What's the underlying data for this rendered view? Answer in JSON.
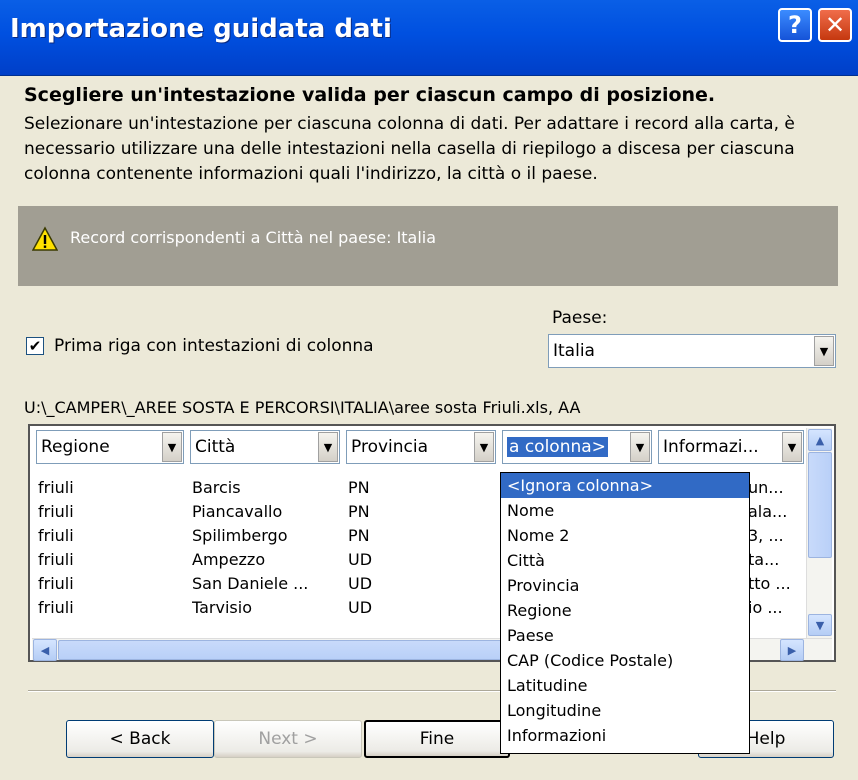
{
  "window": {
    "title": "Importazione guidata dati",
    "help_button": "?",
    "close_button": "✕"
  },
  "header": {
    "heading": "Scegliere un'intestazione valida per ciascun campo di posizione.",
    "description": "Selezionare un'intestazione per ciascuna colonna di dati. Per adattare i record alla carta, è necessario utilizzare una delle intestazioni nella casella di riepilogo a discesa per ciascuna colonna contenente informazioni quali l'indirizzo, la città o il paese."
  },
  "warning": {
    "text": "Record corrispondenti a Città nel paese: Italia",
    "icon": "warning-icon"
  },
  "options": {
    "first_row_label": "Prima riga con intestazioni di colonna",
    "first_row_checked": true,
    "country_label": "Paese:",
    "country_value": "Italia"
  },
  "file_path": "U:\\_CAMPER\\_AREE SOSTA E PERCORSI\\ITALIA\\aree sosta Friuli.xls, AA",
  "grid": {
    "headers": [
      "Regione",
      "Città",
      "Provincia",
      "a colonna>",
      "Informazi..."
    ],
    "rows": [
      [
        "friuli",
        "Barcis",
        "PN",
        "",
        "un..."
      ],
      [
        "friuli",
        "Piancavallo",
        "PN",
        "",
        "ala..."
      ],
      [
        "friuli",
        "Spilimbergo",
        "PN",
        "",
        "3, ..."
      ],
      [
        "friuli",
        "Ampezzo",
        "UD",
        "",
        "ta..."
      ],
      [
        "friuli",
        "San Daniele ...",
        "UD",
        "",
        "tto ..."
      ],
      [
        "friuli",
        "Tarvisio",
        "UD",
        "",
        "io ..."
      ]
    ]
  },
  "dropdown_options": [
    "<Ignora colonna>",
    "Nome",
    "Nome 2",
    "Città",
    "Provincia",
    "Regione",
    "Paese",
    "CAP (Codice Postale)",
    "Latitudine",
    "Longitudine",
    "Informazioni"
  ],
  "dropdown_selected_index": 0,
  "buttons": {
    "back": "< Back",
    "next": "Next >",
    "finish": "Fine",
    "help": "Help"
  }
}
